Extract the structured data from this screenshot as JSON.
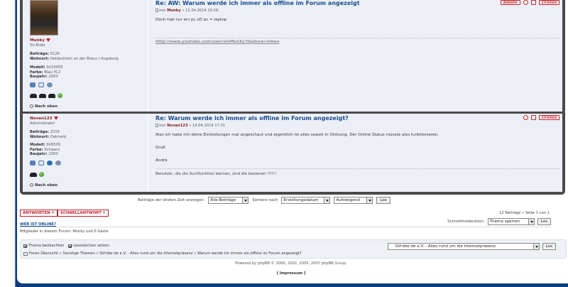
{
  "posts": [
    {
      "author": "Munky",
      "rank": "SV-Rider",
      "beitraege_label": "Beiträge:",
      "beitraege": "5126",
      "wohnort_label": "Wohnort:",
      "wohnort": "Heidenheim an der Brenz / Augsburg",
      "modell_label": "Modell:",
      "modell": "SV1000S",
      "farbe_label": "Farbe:",
      "farbe": "Blau YC2",
      "baujahr_label": "Baujahr:",
      "baujahr": "2003",
      "nach_oben": "Nach oben",
      "title": "Re: AW: Warum werde ich immer als offline im Forum angezeigt",
      "meta_prefix": "von",
      "meta_author": "Munky",
      "meta_date": "» 11.04.2014 10:16",
      "text": "Doch hab nur ein pc xD pc = laptop",
      "link": "http://www.youtube.com/user/eisMunky?feature=mhee",
      "btn_edit": "ÄNDERN",
      "btn_quote": "ZITIEREN"
    },
    {
      "author": "Novan123",
      "rank": "Administrator",
      "beitraege_label": "Beiträge:",
      "beitraege": "2015",
      "wohnort_label": "Wohnort:",
      "wohnort": "Detmold",
      "modell_label": "Modell:",
      "modell": "SV650S",
      "farbe_label": "Farbe:",
      "farbe": "Schwarz",
      "baujahr_label": "Baujahr:",
      "baujahr": "2000",
      "nach_oben": "Nach oben",
      "title": "Re: Warum werde ich immer als offline im Forum angezeigt?",
      "meta_prefix": "von",
      "meta_author": "Novan123",
      "meta_date": "» 14.04.2014 17:31",
      "text1": "Also ich habe mir deine Einstellungen mal angeschaut und eigentlich ist alles soweit in Ordnung. Der Online Status müsste also funktionieren.",
      "text2": "Gruß",
      "text3": "André",
      "signature": "Benutzer, die die Suchfunktion kennen, sind die besseren !!!!!!",
      "btn_quote": "ZITIEREN"
    }
  ],
  "filter": {
    "display_label": "Beiträge der letzten Zeit anzeigen:",
    "display_value": "Alle Beiträge",
    "sort_label": "Sortiere nach",
    "sort_value": "Erstellungsdatum",
    "order_value": "Aufsteigend",
    "go": "Los"
  },
  "actions": {
    "reply": "ANTWORTEN",
    "quick_reply": "SCHNELLANTWORT"
  },
  "pagination": "12 Beiträge • Seite 1 von 1",
  "moderation": {
    "label": "Schnellmoderation:",
    "value": "Thema sperren",
    "go": "Los"
  },
  "who_online": {
    "heading": "WER IST ONLINE?",
    "text": "Mitglieder in diesem Forum: Munky und 0 Gäste"
  },
  "bottom": {
    "watch_topic": "Thema beobachten",
    "bookmark": "Lesezeichen setzen",
    "breadcrumb": "Foren-Übersicht » Sonstige Themen » SVrider.de e.V. - Alles rund um die Internetpräsenz » Warum werde ich immer als offline im Forum angezeigt?",
    "jump_value": "SVrider.de e.V. - Alles rund um die Internetpräsenz",
    "jump_go": "Los"
  },
  "footer": {
    "powered": "Powered by phpBB © 2000, 2002, 2005, 2007 phpBB Group.",
    "impressum": "[ Impressum ]"
  }
}
